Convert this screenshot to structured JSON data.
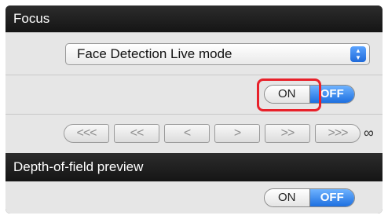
{
  "focus_section": {
    "title": "Focus",
    "mode_select": {
      "value": "Face Detection Live mode"
    },
    "toggle": {
      "on_label": "ON",
      "off_label": "OFF",
      "selected": "OFF"
    },
    "stepper": {
      "buttons": [
        "<<<",
        "<<",
        "<",
        ">",
        ">>",
        ">>>"
      ],
      "infinity_symbol": "∞"
    }
  },
  "dof_section": {
    "title": "Depth-of-field preview",
    "toggle": {
      "on_label": "ON",
      "off_label": "OFF",
      "selected": "OFF"
    }
  },
  "colors": {
    "header_bg": "#191919",
    "row_bg": "#e6e6e6",
    "accent_blue": "#1d6fe0",
    "highlight_red": "#e8212a"
  }
}
